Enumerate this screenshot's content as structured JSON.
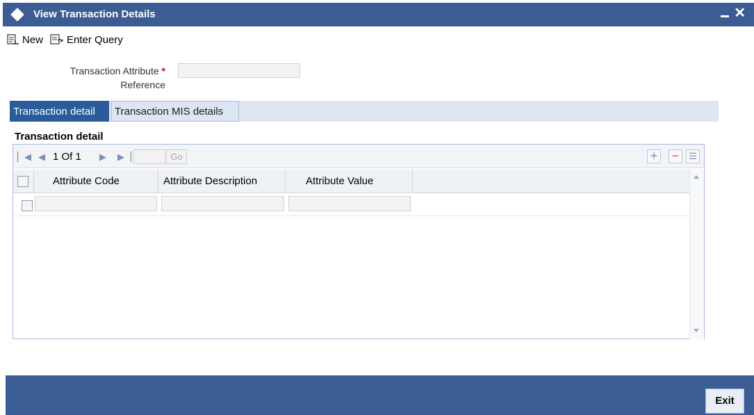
{
  "window": {
    "title": "View Transaction Details",
    "minimize_icon": "minimize-icon",
    "close_icon": "close-icon"
  },
  "toolbar": {
    "new_label": "New",
    "enter_query_label": "Enter Query"
  },
  "form": {
    "reference_label_line1": "Transaction Attribute",
    "reference_label_line2": "Reference",
    "required_mark": "*",
    "reference_value": ""
  },
  "tabs": [
    {
      "label": "Transaction detail",
      "active": true
    },
    {
      "label": "Transaction MIS details",
      "active": false
    }
  ],
  "section": {
    "title": "Transaction detail"
  },
  "pager": {
    "page_text": "1 Of 1",
    "goto_value": "",
    "go_label": "Go"
  },
  "table": {
    "columns": [
      "Attribute Code",
      "Attribute Description",
      "Attribute Value"
    ],
    "rows": [
      {
        "checked": false,
        "code": "",
        "description": "",
        "value": ""
      }
    ]
  },
  "footer": {
    "exit_label": "Exit"
  },
  "colors": {
    "title_bar": "#3c5d93",
    "active_tab": "#2b5c9a",
    "tab_bar": "#dde5f3",
    "required": "#dd0000"
  }
}
